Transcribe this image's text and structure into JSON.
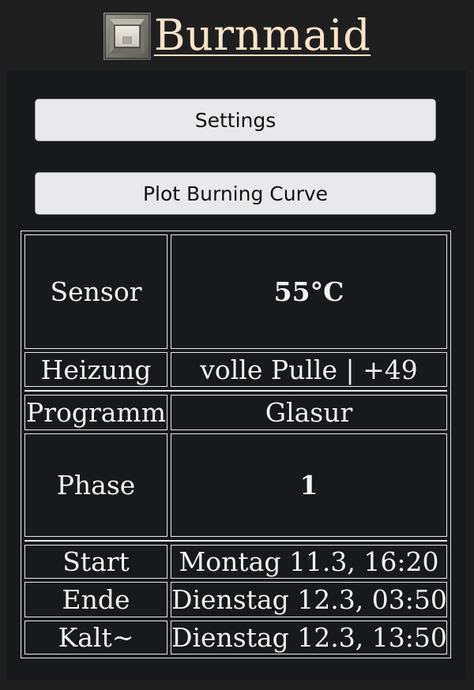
{
  "header": {
    "title": "Burnmaid",
    "logo_icon": "kiln-icon"
  },
  "buttons": {
    "settings": "Settings",
    "plot": "Plot Burning Curve"
  },
  "status": {
    "sensor_label": "Sensor",
    "sensor_value": "55°C",
    "heizung_label": "Heizung",
    "heizung_value": "volle Pulle | +49",
    "programm_label": "Programm",
    "programm_value": "Glasur",
    "phase_label": "Phase",
    "phase_value": "1",
    "start_label": "Start",
    "start_value": "Montag 11.3, 16:20",
    "ende_label": "Ende",
    "ende_value": "Dienstag 12.3, 03:50",
    "kalt_label": "Kalt~",
    "kalt_value": "Dienstag 12.3, 13:50"
  },
  "colors": {
    "background": "#1f1f20",
    "panel": "#18191d",
    "title": "#fde3c8",
    "temperature": "#0a8a80",
    "button": "#e9e9ed"
  }
}
